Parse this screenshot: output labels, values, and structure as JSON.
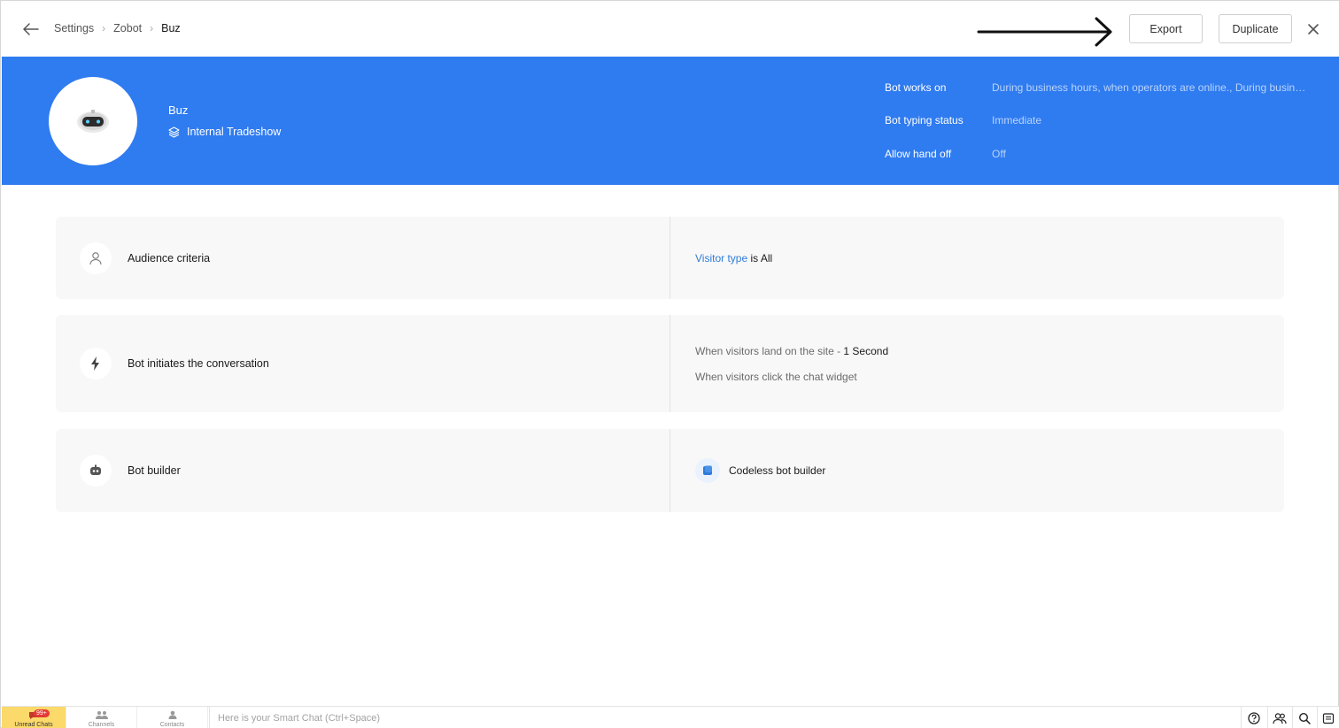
{
  "breadcrumb": {
    "items": [
      "Settings",
      "Zobot"
    ],
    "current": "Buz"
  },
  "actions": {
    "export_label": "Export",
    "duplicate_label": "Duplicate"
  },
  "banner": {
    "bot_name": "Buz",
    "department": "Internal Tradeshow",
    "info": [
      {
        "key": "Bot works on",
        "value": "During business hours, when operators are online., During business hours, when operators are offline., After business hours"
      },
      {
        "key": "Bot typing status",
        "value": "Immediate"
      },
      {
        "key": "Allow hand off",
        "value": "Off"
      }
    ]
  },
  "cards": {
    "audience": {
      "title": "Audience criteria",
      "criteria_link": "Visitor type",
      "criteria_rest": " is All"
    },
    "initiates": {
      "title": "Bot initiates the conversation",
      "line1_prefix": "When visitors land on the site - ",
      "line1_value": "1 Second",
      "line2": "When visitors click the chat widget"
    },
    "builder": {
      "title": "Bot builder",
      "value": "Codeless bot builder"
    }
  },
  "bottombar": {
    "unread_label": "Unread Chats",
    "unread_badge": "99+",
    "channels_label": "Channels",
    "contacts_label": "Contacts",
    "smart_chat_placeholder": "Here is your Smart Chat (Ctrl+Space)"
  },
  "colors": {
    "banner": "#2f7bf0",
    "link": "#2f7bd9",
    "unread_tab": "#fbd96a",
    "badge": "#e53935"
  },
  "icons": [
    "arrow-left-icon",
    "chevron-right-icon",
    "close-icon",
    "robot-icon",
    "layers-icon",
    "user-icon",
    "bolt-icon",
    "bot-builder-icon",
    "codeless-builder-icon",
    "help-icon",
    "operators-icon",
    "search-icon",
    "notes-icon"
  ]
}
